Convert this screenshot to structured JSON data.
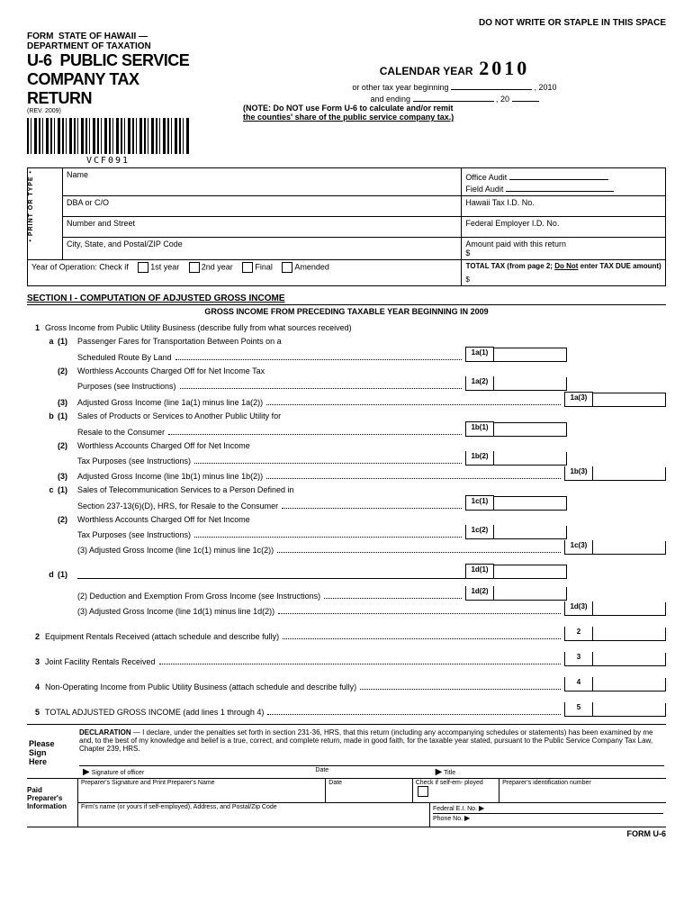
{
  "topnote": "DO NOT WRITE OR STAPLE IN THIS SPACE",
  "header": {
    "form_word": "FORM",
    "dept": "STATE OF HAWAII — DEPARTMENT OF TAXATION",
    "form_no": "U-6",
    "title": "PUBLIC SERVICE COMPANY TAX RETURN",
    "rev": "(REV. 2009)",
    "cal_year_label": "CALENDAR YEAR",
    "cal_year": "2010",
    "other_begin": "or other tax year  beginning",
    "year_suffix": ", 2010",
    "and_ending": "and ending",
    "year_prefix": ", 20",
    "note1": "(NOTE:  Do NOT use Form U-6 to calculate and/or remit",
    "note2": "the counties' share of the public service company tax.)",
    "code": "VCF091"
  },
  "idbox": {
    "side": "• PRINT OR TYPE •",
    "name": "Name",
    "dba": "DBA or C/O",
    "street": "Number and Street",
    "city": "City, State, and Postal/ZIP Code",
    "office_audit": "Office Audit",
    "field_audit": "Field Audit",
    "hi_tax": "Hawaii Tax I.D. No.",
    "fed_ein": "Federal Employer I.D. No.",
    "amount_paid": "Amount paid with this return",
    "dollar": "$",
    "total_tax1": "TOTAL TAX (from page 2; ",
    "total_tax_underline": "Do Not",
    "total_tax2": " enter TAX DUE amount)",
    "yearop_label": "Year of Operation: Check if",
    "cb1": "1st year",
    "cb2": "2nd year",
    "cb3": "Final",
    "cb4": "Amended"
  },
  "section1": {
    "title": "SECTION I - COMPUTATION OF ADJUSTED GROSS INCOME",
    "sub": "GROSS INCOME FROM PRECEDING TAXABLE YEAR BEGINNING IN 2009",
    "l1": "Gross Income from Public Utility Business (describe fully from what sources received)",
    "a1a": "Passenger Fares for Transportation Between Points on a",
    "a1b": "Scheduled Route By Land",
    "a2a": "Worthless Accounts Charged Off for Net Income Tax",
    "a2b": "Purposes (see Instructions)",
    "a3": "Adjusted Gross Income (line 1a(1) minus line 1a(2))",
    "b1a": "Sales of Products or Services to Another Public Utility for",
    "b1b": "Resale to the Consumer",
    "b2a": "Worthless Accounts Charged Off for Net Income",
    "b2b": "Tax Purposes (see Instructions)",
    "b3": "Adjusted Gross Income (line 1b(1) minus line 1b(2))",
    "c1a": "Sales of Telecommunication Services to a Person Defined in",
    "c1b": "Section 237-13(6)(D), HRS, for Resale to the Consumer",
    "c2a": "Worthless Accounts Charged Off for Net Income",
    "c2b": "Tax Purposes (see Instructions)",
    "c3": "(3) Adjusted Gross Income (line 1c(1) minus line 1c(2))",
    "d2": "(2) Deduction and Exemption From Gross Income (see Instructions)",
    "d3": "(3) Adjusted Gross Income (line 1d(1) minus line 1d(2))",
    "l2": "Equipment Rentals Received (attach schedule and describe fully)",
    "l3": "Joint Facility Rentals Received",
    "l4": "Non-Operating Income from Public Utility Business (attach schedule and describe fully)",
    "l5": "TOTAL ADJUSTED GROSS INCOME (add lines 1 through 4)",
    "boxes": {
      "a1": "1a(1)",
      "a2": "1a(2)",
      "a3": "1a(3)",
      "b1": "1b(1)",
      "b2": "1b(2)",
      "b3": "1b(3)",
      "c1": "1c(1)",
      "c2": "1c(2)",
      "c3": "1c(3)",
      "d1": "1d(1)",
      "d2": "1d(2)",
      "d3": "1d(3)",
      "n2": "2",
      "n3": "3",
      "n4": "4",
      "n5": "5"
    }
  },
  "declaration": {
    "head": "DECLARATION",
    "body": " — I declare, under the penalties set forth in section 231-36, HRS, that this return (including any accompanying schedules or statements) has been examined by me and, to the best of my knowledge and belief is a true, correct, and complete return, made in good faith, for the taxable year stated, pursuant to the Public Service Company Tax Law, Chapter 239, HRS.",
    "please": "Please",
    "sign": "Sign",
    "here": "Here",
    "sig_officer": "Signature of officer",
    "date": "Date",
    "title": "Title"
  },
  "preparer": {
    "paid": "Paid",
    "prep": "Preparer's",
    "info": "Information",
    "sig": "Preparer's Signature and Print Preparer's Name",
    "date": "Date",
    "checkif": "Check if self-em- ployed",
    "pid": "Preparer's identification number",
    "firm": "Firm's name (or yours if self-employed), Address, and Postal/Zip Code",
    "fedein": "Federal E.I. No.",
    "phone": "Phone No."
  },
  "footer": "FORM U-6"
}
